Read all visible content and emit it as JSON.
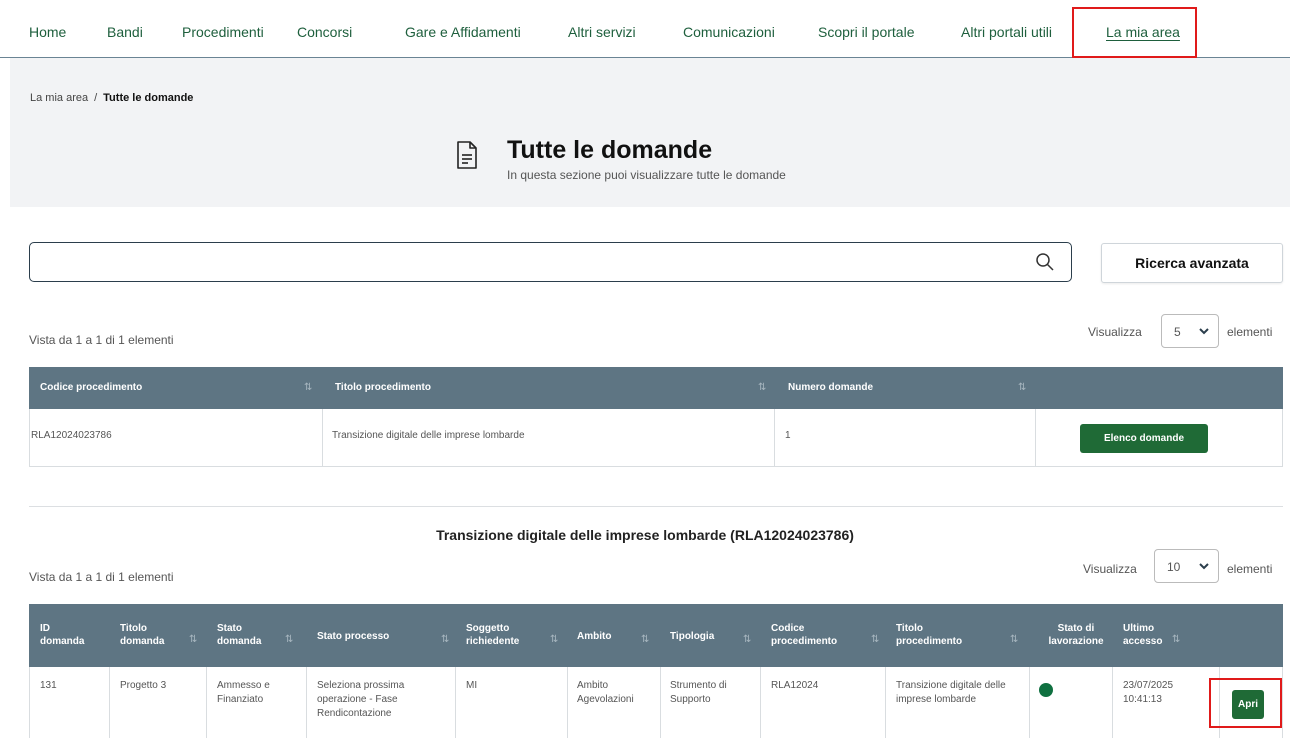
{
  "nav": {
    "items": [
      "Home",
      "Bandi",
      "Procedimenti",
      "Concorsi",
      "Gare e Affidamenti",
      "Altri servizi",
      "Comunicazioni",
      "Scopri il portale",
      "Altri portali utili",
      "La mia area"
    ]
  },
  "breadcrumb": {
    "parent": "La mia area",
    "separator": "/",
    "current": "Tutte le domande"
  },
  "page": {
    "title": "Tutte le domande",
    "subtitle": "In questa sezione puoi visualizzare tutte le domande"
  },
  "search": {
    "value": "",
    "advanced_label": "Ricerca avanzata"
  },
  "table1": {
    "info": "Vista da 1 a 1 di 1 elementi",
    "show_label": "Visualizza",
    "show_value": "5",
    "show_suffix": "elementi",
    "headers": [
      "Codice procedimento",
      "Titolo procedimento",
      "Numero domande"
    ],
    "rows": [
      {
        "codice": "RLA12024023786",
        "titolo": "Transizione digitale delle imprese lombarde",
        "numero": "1",
        "action": "Elenco domande"
      }
    ]
  },
  "section": {
    "title": "Transizione digitale delle imprese lombarde (RLA12024023786)"
  },
  "table2": {
    "info": "Vista da 1 a 1 di 1 elementi",
    "show_label": "Visualizza",
    "show_value": "10",
    "show_suffix": "elementi",
    "headers": [
      [
        "ID",
        "domanda"
      ],
      [
        "Titolo",
        "domanda"
      ],
      [
        "Stato",
        "domanda"
      ],
      [
        "Stato processo"
      ],
      [
        "Soggetto",
        "richiedente"
      ],
      [
        "Ambito"
      ],
      [
        "Tipologia"
      ],
      [
        "Codice",
        "procedimento"
      ],
      [
        "Titolo",
        "procedimento"
      ],
      [
        "Stato di",
        "lavorazione"
      ],
      [
        "Ultimo",
        "accesso"
      ]
    ],
    "rows": [
      {
        "id": "131",
        "titolo": "Progetto 3",
        "stato": [
          "Ammesso e",
          "Finanziato"
        ],
        "processo": [
          "Seleziona prossima",
          "operazione - Fase",
          "Rendicontazione"
        ],
        "soggetto": "MI",
        "ambito": [
          "Ambito",
          "Agevolazioni"
        ],
        "tipologia": [
          "Strumento di",
          "Supporto"
        ],
        "codice": "RLA12024",
        "titolo_proc": [
          "Transizione digitale delle",
          "imprese lombarde"
        ],
        "lavorazione_color": "#0f7040",
        "ultimo": [
          "23/07/2025",
          "10:41:13"
        ],
        "action": "Apri"
      }
    ]
  },
  "colors": {
    "nav_link": "#1e5f3d",
    "table_header": "#5e7583",
    "button_green": "#1f6a36",
    "highlight": "#e01a1a"
  }
}
